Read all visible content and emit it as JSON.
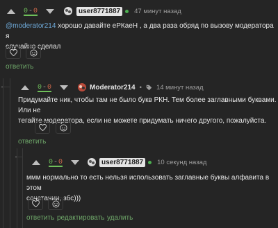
{
  "comments": [
    {
      "rating": {
        "pos": "0",
        "neg": "0",
        "sep": "-"
      },
      "username": "user8771887",
      "time": "47 минут назад",
      "mention": "@moderator214",
      "text_line1_after_mention": " хорошо давайте еРКаеН , а два раза обряд по вызову модератора я",
      "text_line2": "случайно сделал",
      "reply_label": "ответить"
    },
    {
      "rating": {
        "pos": "0",
        "neg": "0",
        "sep": "-"
      },
      "username": "Moderator214",
      "time": "14 минут назад",
      "text_line1": "Придумайте ник, чтобы там не было букв РКН. Тем более заглавными буквами. Или не",
      "text_line2": "тегайте модератора, если не можете придумать ничего другого, пожалуйста.",
      "reply_label": "ответить"
    },
    {
      "rating": {
        "pos": "0",
        "neg": "0",
        "sep": "-"
      },
      "username": "user8771887",
      "time": "10 секунд назад",
      "text_line1": "ммм нормально то есть нельзя использовать заглавные буквы алфавита в этом",
      "text_line2": "сочетании, збс)))",
      "reply_label": "ответить",
      "edit_label": "редактировать",
      "delete_label": "удалить"
    }
  ],
  "icons": {
    "heart": "heart-icon",
    "smile": "emoji-icon",
    "tag": "tag-icon",
    "more": "more-icon"
  },
  "colors": {
    "background": "#252525",
    "positive": "#6fbf5a",
    "negative": "#d46a4c",
    "mention": "#6ea9d8",
    "link": "#6fa86a",
    "online": "#4caf50"
  }
}
